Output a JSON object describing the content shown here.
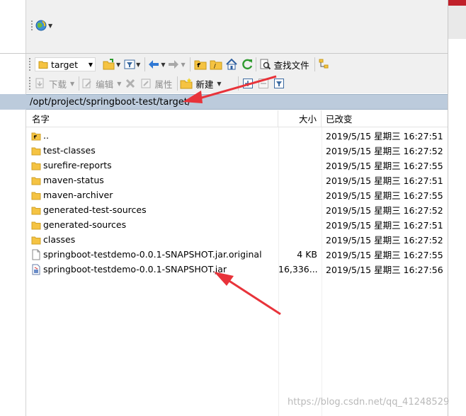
{
  "toolbar": {
    "current_dir": "target",
    "find_files_label": "查找文件",
    "download_label": "下载",
    "edit_label": "编辑",
    "properties_label": "属性",
    "new_label": "新建"
  },
  "path": "/opt/project/springboot-test/target/",
  "columns": {
    "name": "名字",
    "size": "大小",
    "modified": "已改变"
  },
  "files": [
    {
      "name": "..",
      "size": "",
      "modified": "2019/5/15 星期三 16:27:51",
      "icon": "parent-dir-icon"
    },
    {
      "name": "test-classes",
      "size": "",
      "modified": "2019/5/15 星期三 16:27:52",
      "icon": "folder-icon"
    },
    {
      "name": "surefire-reports",
      "size": "",
      "modified": "2019/5/15 星期三 16:27:55",
      "icon": "folder-icon"
    },
    {
      "name": "maven-status",
      "size": "",
      "modified": "2019/5/15 星期三 16:27:51",
      "icon": "folder-icon"
    },
    {
      "name": "maven-archiver",
      "size": "",
      "modified": "2019/5/15 星期三 16:27:55",
      "icon": "folder-icon"
    },
    {
      "name": "generated-test-sources",
      "size": "",
      "modified": "2019/5/15 星期三 16:27:52",
      "icon": "folder-icon"
    },
    {
      "name": "generated-sources",
      "size": "",
      "modified": "2019/5/15 星期三 16:27:51",
      "icon": "folder-icon"
    },
    {
      "name": "classes",
      "size": "",
      "modified": "2019/5/15 星期三 16:27:52",
      "icon": "folder-icon"
    },
    {
      "name": "springboot-testdemo-0.0.1-SNAPSHOT.jar.original",
      "size": "4 KB",
      "modified": "2019/5/15 星期三 16:27:55",
      "icon": "file-icon"
    },
    {
      "name": "springboot-testdemo-0.0.1-SNAPSHOT.jar",
      "size": "16,336...",
      "modified": "2019/5/15 星期三 16:27:56",
      "icon": "jar-file-icon"
    }
  ],
  "watermark": "https://blog.csdn.net/qq_41248529",
  "colors": {
    "path_bar": "#bccbdc",
    "annotation_arrow": "#e8333a",
    "folder": "#f5c342"
  }
}
